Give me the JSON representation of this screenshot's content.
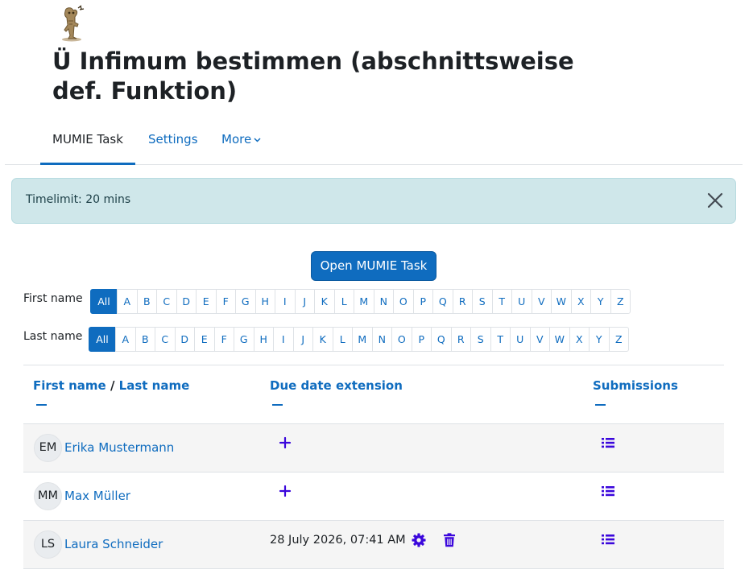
{
  "page": {
    "title": "Ü Infimum bestimmen (abschnittsweise def. Funktion)"
  },
  "tabs": [
    {
      "label": "MUMIE Task",
      "active": true
    },
    {
      "label": "Settings",
      "active": false
    },
    {
      "label": "More",
      "active": false
    }
  ],
  "alert": {
    "text": "Timelimit: 20 mins"
  },
  "open_button": {
    "label": "Open MUMIE Task"
  },
  "initials_filter": {
    "first_name_label": "First name",
    "last_name_label": "Last name",
    "letters": [
      "All",
      "A",
      "B",
      "C",
      "D",
      "E",
      "F",
      "G",
      "H",
      "I",
      "J",
      "K",
      "L",
      "M",
      "N",
      "O",
      "P",
      "Q",
      "R",
      "S",
      "T",
      "U",
      "V",
      "W",
      "X",
      "Y",
      "Z"
    ],
    "selected": "All"
  },
  "table": {
    "headers": {
      "first_name": "First name",
      "separator": "/",
      "last_name": "Last name",
      "due_date_extension": "Due date extension",
      "submissions": "Submissions"
    },
    "rows": [
      {
        "initials": "EM",
        "name": "Erika Mustermann",
        "due_date": ""
      },
      {
        "initials": "MM",
        "name": "Max Müller",
        "due_date": ""
      },
      {
        "initials": "LS",
        "name": "Laura Schneider",
        "due_date": "28 July 2026, 07:41 AM"
      }
    ]
  },
  "colors": {
    "link": "#0f6cbf",
    "action_icon": "#3b07dc",
    "alert_bg": "#cfe7ea"
  },
  "icons": {
    "add": "plus-icon",
    "settings": "gear-icon",
    "delete": "trash-icon",
    "submissions": "list-icon",
    "close": "close-icon",
    "dropdown": "chevron-down-icon"
  }
}
